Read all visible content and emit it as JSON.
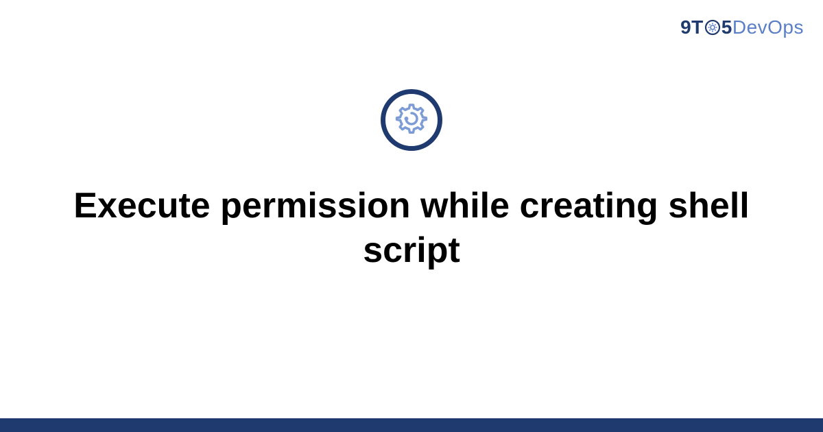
{
  "logo": {
    "prefix": "9T",
    "suffix": "5",
    "brand": "DevOps"
  },
  "title": "Execute permission while creating shell script",
  "colors": {
    "dark_blue": "#1e3a6e",
    "light_blue": "#5b7fc7",
    "gear_stroke": "#7d9bd4"
  }
}
